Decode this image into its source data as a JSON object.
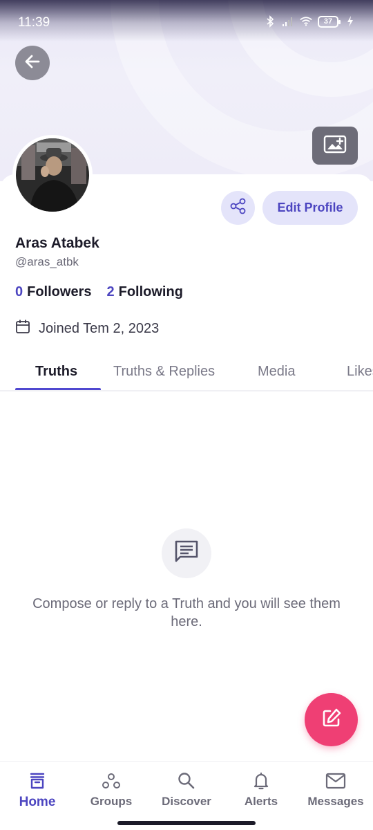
{
  "status_bar": {
    "time": "11:39",
    "battery": "37",
    "icons": [
      "bluetooth-icon",
      "signal-icon",
      "wifi-icon",
      "battery-icon",
      "charging-icon"
    ]
  },
  "header": {
    "back_icon": "arrow-left-icon",
    "cover_icon": "add-photo-icon"
  },
  "profile": {
    "display_name": "Aras Atabek",
    "handle": "@aras_atbk",
    "followers_count": "0",
    "followers_label": "Followers",
    "following_count": "2",
    "following_label": "Following",
    "joined": "Joined Tem 2, 2023",
    "edit_button": "Edit Profile",
    "share_icon": "share-icon"
  },
  "tabs": [
    {
      "label": "Truths",
      "active": true
    },
    {
      "label": "Truths & Replies",
      "active": false
    },
    {
      "label": "Media",
      "active": false
    },
    {
      "label": "Likes",
      "active": false
    }
  ],
  "empty_state": {
    "icon": "message-icon",
    "text": "Compose or reply to a Truth and you will see them here."
  },
  "fab": {
    "icon": "compose-icon"
  },
  "bottom_nav": [
    {
      "label": "Home",
      "icon": "home-icon",
      "active": true
    },
    {
      "label": "Groups",
      "icon": "groups-icon",
      "active": false
    },
    {
      "label": "Discover",
      "icon": "search-icon",
      "active": false
    },
    {
      "label": "Alerts",
      "icon": "bell-icon",
      "active": false
    },
    {
      "label": "Messages",
      "icon": "mail-icon",
      "active": false
    }
  ],
  "colors": {
    "accent": "#4c45c0",
    "fab": "#ef3f74",
    "button_bg": "#e4e4fa"
  }
}
